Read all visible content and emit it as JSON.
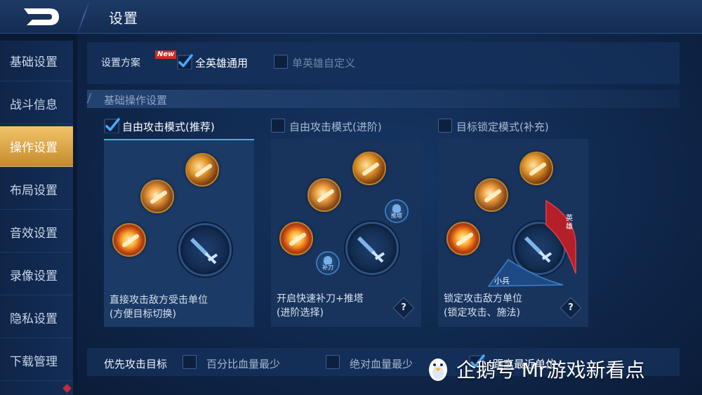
{
  "header": {
    "title": "设置"
  },
  "sidebar": {
    "items": [
      {
        "label": "基础设置",
        "active": false
      },
      {
        "label": "战斗信息",
        "active": false
      },
      {
        "label": "操作设置",
        "active": true
      },
      {
        "label": "布局设置",
        "active": false
      },
      {
        "label": "音效设置",
        "active": false
      },
      {
        "label": "录像设置",
        "active": false
      },
      {
        "label": "隐私设置",
        "active": false
      },
      {
        "label": "下载管理",
        "active": false
      }
    ]
  },
  "scheme": {
    "label": "设置方案",
    "badge": "New",
    "options": [
      {
        "label": "全英雄通用",
        "checked": true
      },
      {
        "label": "单英雄自定义",
        "checked": false
      }
    ]
  },
  "section": {
    "title": "基础操作设置"
  },
  "modes": [
    {
      "label": "自由攻击模式(推荐)",
      "checked": true,
      "desc_line1": "直接攻击敌方受击单位",
      "desc_line2": "(方便目标切换)",
      "has_help": false
    },
    {
      "label": "自由攻击模式(进阶)",
      "checked": false,
      "desc_line1": "开启快速补刀+推塔",
      "desc_line2": "(进阶选择)",
      "has_help": true,
      "help": "?",
      "mini_buttons": [
        "推塔",
        "补刀"
      ]
    },
    {
      "label": "目标锁定模式(补充)",
      "checked": false,
      "desc_line1": "锁定攻击敌方单位",
      "desc_line2": "(锁定攻击、施法)",
      "has_help": true,
      "help": "?",
      "hero_tab": "英雄",
      "minion_tab": "小兵"
    }
  ],
  "priority": {
    "label": "优先攻击目标",
    "options": [
      {
        "label": "百分比血量最少",
        "checked": false
      },
      {
        "label": "绝对血量最少",
        "checked": false
      },
      {
        "label": "距离最近单位",
        "checked": true
      }
    ]
  },
  "watermark": {
    "text": "企鹅号 Mr游戏新看点"
  },
  "colors": {
    "accent_gold": "#d9a443",
    "accent_cyan": "#37b7d9",
    "check_blue": "#4aa8ff"
  }
}
